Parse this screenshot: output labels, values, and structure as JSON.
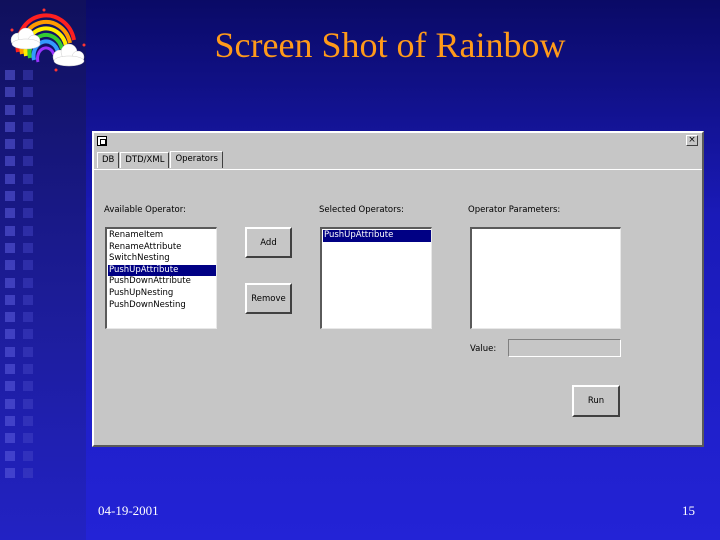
{
  "slide": {
    "title": "Screen Shot of Rainbow",
    "date": "04-19-2001",
    "page_number": "15"
  },
  "window": {
    "close_glyph": "×",
    "tabs": [
      {
        "label": "DB",
        "active": false
      },
      {
        "label": "DTD/XML",
        "active": false
      },
      {
        "label": "Operators",
        "active": true
      }
    ],
    "available": {
      "label": "Available Operator:",
      "items": [
        "RenameItem",
        "RenameAttribute",
        "SwitchNesting",
        "PushUpAttribute",
        "PushDownAttribute",
        "PushUpNesting",
        "PushDownNesting"
      ],
      "selected_index": 3
    },
    "add_label": "Add",
    "remove_label": "Remove",
    "selected": {
      "label": "Selected Operators:",
      "items": [
        "PushUpAttribute"
      ],
      "selected_index": 0
    },
    "parameters": {
      "label": "Operator Parameters:"
    },
    "value": {
      "label": "Value:",
      "value": ""
    },
    "run_label": "Run"
  },
  "colors": {
    "title": "#ff9a1a",
    "selection": "#000084",
    "window_bg": "#c6c6c6"
  }
}
